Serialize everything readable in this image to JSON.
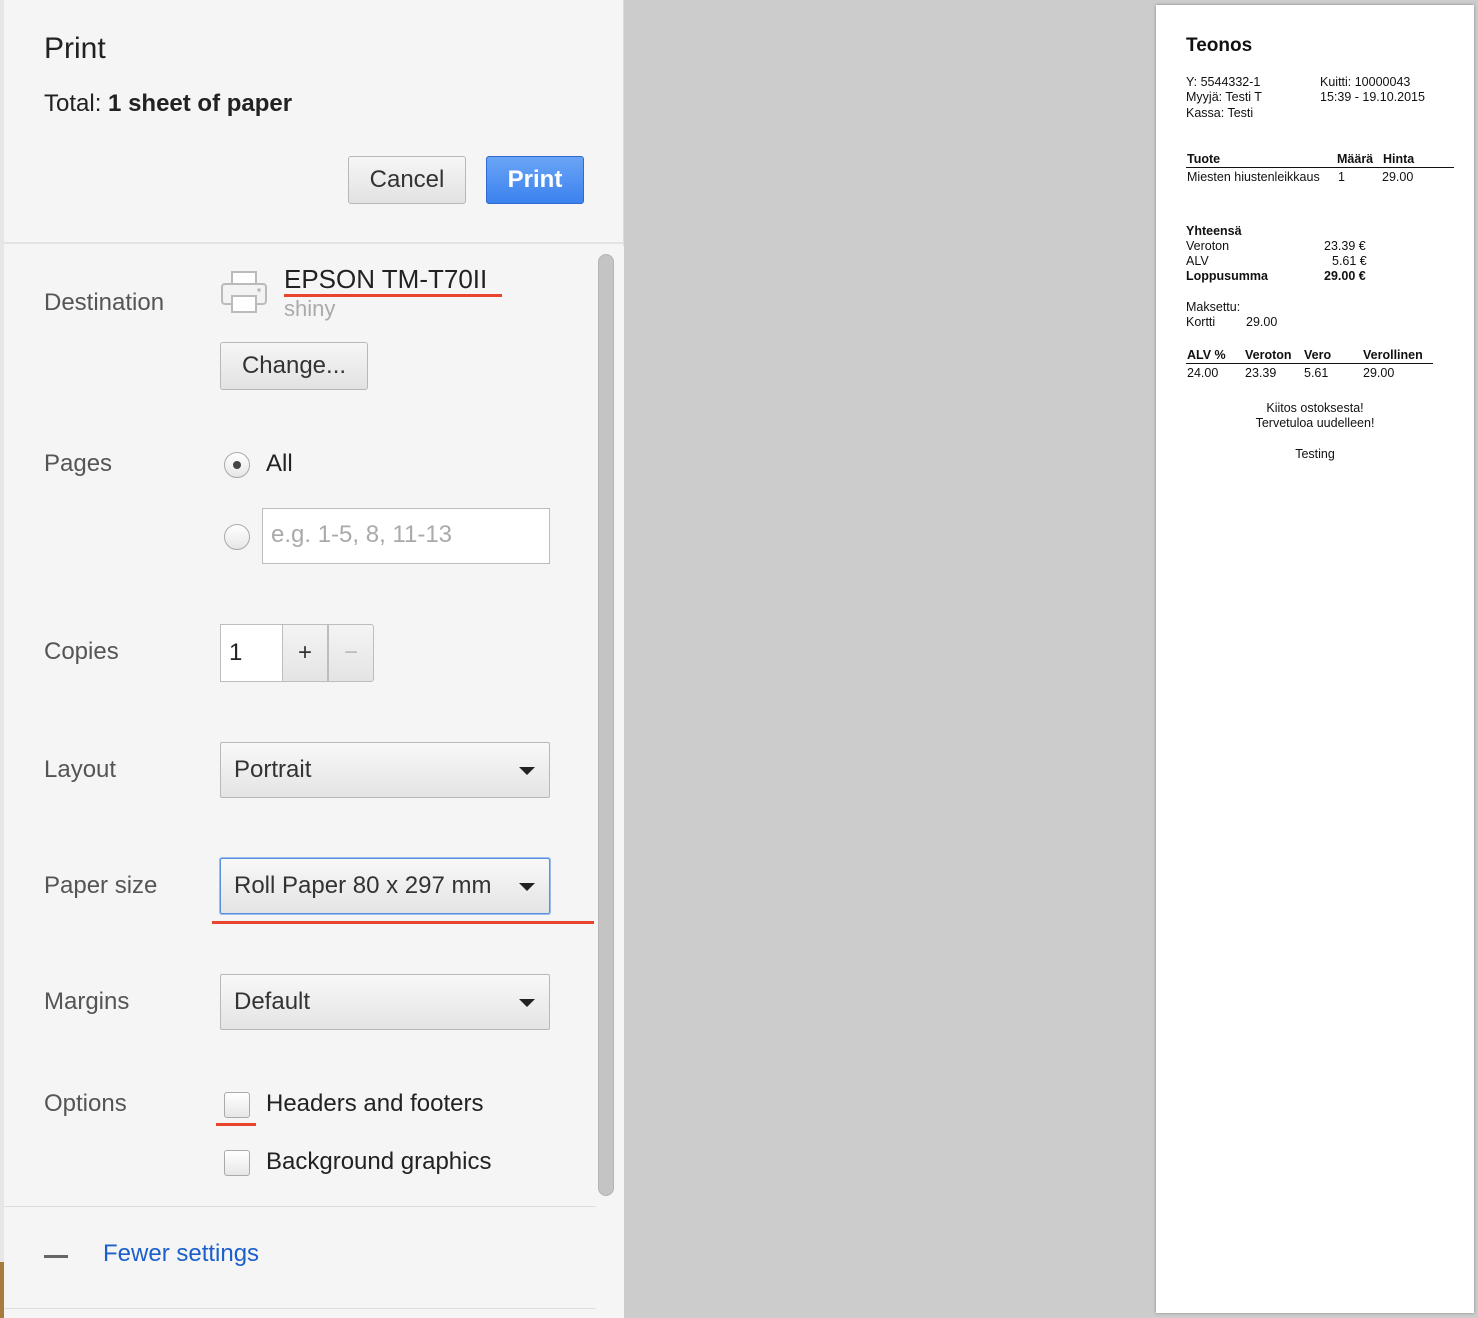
{
  "header": {
    "title": "Print",
    "total_label": "Total:",
    "total_value": "1 sheet of paper",
    "cancel_label": "Cancel",
    "print_label": "Print"
  },
  "destination": {
    "label": "Destination",
    "printer_name": "EPSON TM-T70II",
    "printer_sub": "shiny",
    "change_label": "Change..."
  },
  "pages": {
    "label": "Pages",
    "all_label": "All",
    "range_placeholder": "e.g. 1-5, 8, 11-13",
    "selected": "All"
  },
  "copies": {
    "label": "Copies",
    "value": "1",
    "plus": "+",
    "minus": "−"
  },
  "layout": {
    "label": "Layout",
    "value": "Portrait"
  },
  "paper_size": {
    "label": "Paper size",
    "value": "Roll Paper 80 x 297 mm"
  },
  "margins": {
    "label": "Margins",
    "value": "Default"
  },
  "options": {
    "label": "Options",
    "headers_footers": "Headers and footers",
    "headers_footers_checked": false,
    "background_graphics": "Background graphics",
    "background_graphics_checked": false
  },
  "footer": {
    "fewer_settings": "Fewer settings"
  },
  "receipt": {
    "title": "Teonos",
    "y_id": "Y: 5544332-1",
    "seller": "Myyjä: Testi T",
    "register": "Kassa: Testi",
    "receipt_no": "Kuitti: 10000043",
    "datetime": "15:39 - 19.10.2015",
    "col_product": "Tuote",
    "col_qty": "Määrä",
    "col_price": "Hinta",
    "item_name": "Miesten hiustenleikkaus",
    "item_qty": "1",
    "item_price": "29.00",
    "total_heading": "Yhteensä",
    "net_label": "Veroton",
    "net_value": "23.39 €",
    "vat_label": "ALV",
    "vat_value": "5.61 €",
    "grand_label": "Loppusumma",
    "grand_value": "29.00 €",
    "paid_label": "Maksettu:",
    "card_label": "Kortti",
    "card_value": "29.00",
    "tax_col_rate": "ALV %",
    "tax_col_net": "Veroton",
    "tax_col_tax": "Vero",
    "tax_col_gross": "Verollinen",
    "tax_rate": "24.00",
    "tax_net": "23.39",
    "tax_tax": "5.61",
    "tax_gross": "29.00",
    "thanks": "Kiitos ostoksesta!",
    "welcome": "Tervetuloa uudelleen!",
    "footer_note": "Testing"
  },
  "colors": {
    "accent": "#3c82ef",
    "annotation": "#e8452c",
    "link": "#1a5fcc"
  }
}
